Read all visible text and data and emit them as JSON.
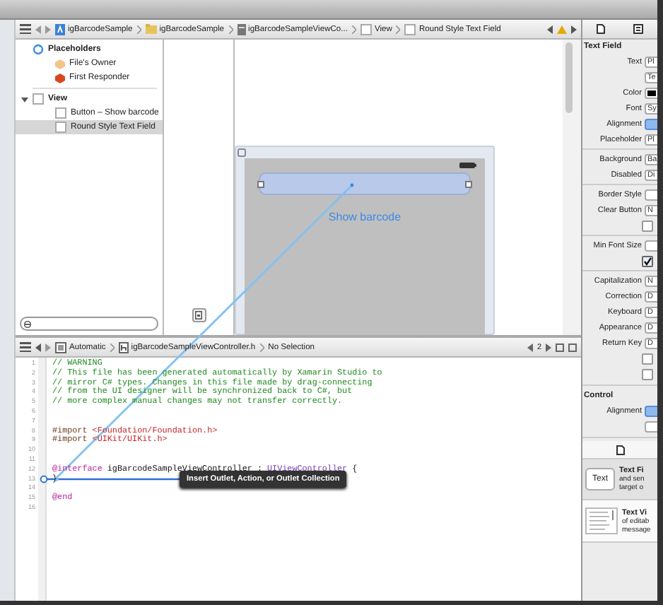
{
  "jump_bar": {
    "items": [
      {
        "label": "igBarcodeSample",
        "kind": "project"
      },
      {
        "label": "igBarcodeSample",
        "kind": "folder"
      },
      {
        "label": "igBarcodeSampleViewCo...",
        "kind": "file"
      },
      {
        "label": "View",
        "kind": "view"
      },
      {
        "label": "Round Style Text Field",
        "kind": "view"
      }
    ]
  },
  "outline": [
    {
      "label": "Placeholders",
      "kind": "placeholders",
      "selected": false,
      "children": [
        {
          "label": "File's Owner",
          "kind": "owner",
          "selected": false
        },
        {
          "label": "First Responder",
          "kind": "responder",
          "selected": false
        }
      ]
    },
    {
      "label": "View",
      "kind": "view",
      "expanded": true,
      "selected": false,
      "children": [
        {
          "label": "Button – Show barcode",
          "kind": "view",
          "selected": false
        },
        {
          "label": "Round Style Text Field",
          "kind": "view",
          "selected": true
        }
      ]
    }
  ],
  "canvas": {
    "text_field": {
      "selected": true
    },
    "button": {
      "label": "Show barcode"
    }
  },
  "editor": {
    "jump_bar": {
      "items": [
        {
          "label": "Automatic",
          "kind": "automatic"
        },
        {
          "label": "igBarcodeSampleViewController.h",
          "kind": "header"
        },
        {
          "label": "No Selection",
          "kind": "plain"
        }
      ],
      "counter": "2"
    },
    "lines": [
      {
        "number": "1",
        "segments": [
          {
            "text": "// WARNING",
            "kind": "comment"
          }
        ]
      },
      {
        "number": "2",
        "segments": [
          {
            "text": "// This file has been generated automatically by Xamarin Studio to",
            "kind": "comment"
          }
        ]
      },
      {
        "number": "3",
        "segments": [
          {
            "text": "// mirror C# types. Changes in this file made by drag-connecting",
            "kind": "comment"
          }
        ]
      },
      {
        "number": "4",
        "segments": [
          {
            "text": "// from the UI designer will be synchronized back to C#, but",
            "kind": "comment"
          }
        ]
      },
      {
        "number": "5",
        "segments": [
          {
            "text": "// more complex manual changes may not transfer correctly.",
            "kind": "comment"
          }
        ]
      },
      {
        "number": "6"
      },
      {
        "number": "7"
      },
      {
        "number": "8",
        "segments": [
          {
            "text": "#import ",
            "kind": "directive"
          },
          {
            "text": "<Foundation/Foundation.h>",
            "kind": "string"
          }
        ]
      },
      {
        "number": "9",
        "segments": [
          {
            "text": "#import ",
            "kind": "directive"
          },
          {
            "text": "<UIKit/UIKit.h>",
            "kind": "string"
          }
        ]
      },
      {
        "number": "10"
      },
      {
        "number": "11"
      },
      {
        "number": "12",
        "segments": [
          {
            "text": "@interface",
            "kind": "keyword"
          },
          {
            "text": " igBarcodeSampleViewController : ",
            "kind": "plain"
          },
          {
            "text": "UIViewController",
            "kind": "type"
          },
          {
            "text": " {",
            "kind": "plain"
          }
        ]
      },
      {
        "number": "13",
        "segments": [
          {
            "text": "}",
            "kind": "plain"
          }
        ]
      },
      {
        "number": "14"
      },
      {
        "number": "15",
        "segments": [
          {
            "text": "@end",
            "kind": "keyword"
          }
        ]
      },
      {
        "number": "16"
      }
    ],
    "tooltip": "Insert Outlet, Action, or Outlet Collection"
  },
  "inspector": {
    "sections": [
      {
        "title": "Text Field",
        "rows": [
          {
            "kind": "field",
            "label": "Text",
            "value": "Pl"
          },
          {
            "kind": "field",
            "value": "Te"
          },
          {
            "kind": "color",
            "label": "Color"
          },
          {
            "kind": "field",
            "label": "Font",
            "value": "Sy"
          },
          {
            "kind": "segmented",
            "label": "Alignment",
            "selected": true
          },
          {
            "kind": "field",
            "label": "Placeholder",
            "value": "Pl"
          },
          {
            "kind": "divider"
          },
          {
            "kind": "field",
            "label": "Background",
            "value": "Ba"
          },
          {
            "kind": "field",
            "label": "Disabled",
            "value": "Di"
          },
          {
            "kind": "divider"
          },
          {
            "kind": "field",
            "label": "Border Style"
          },
          {
            "kind": "field",
            "label": "Clear Button",
            "value": "N"
          },
          {
            "kind": "checkbox",
            "checked": false
          },
          {
            "kind": "divider"
          },
          {
            "kind": "field",
            "label": "Min Font Size"
          },
          {
            "kind": "checkbox",
            "checked": true
          },
          {
            "kind": "divider"
          },
          {
            "kind": "field",
            "label": "Capitalization",
            "value": "N"
          },
          {
            "kind": "field",
            "label": "Correction",
            "value": "D"
          },
          {
            "kind": "field",
            "label": "Keyboard",
            "value": "D"
          },
          {
            "kind": "field",
            "label": "Appearance",
            "value": "D"
          },
          {
            "kind": "field",
            "label": "Return Key",
            "value": "D"
          },
          {
            "kind": "checkbox",
            "checked": false
          },
          {
            "kind": "checkbox",
            "checked": false
          }
        ]
      },
      {
        "title": "Control",
        "rows": [
          {
            "kind": "segmented",
            "label": "Alignment",
            "selected": true
          },
          {
            "kind": "button"
          }
        ]
      }
    ],
    "library": [
      {
        "kind": "textfield",
        "badge": "Text",
        "title": "Text Fi",
        "lines": [
          "and sen",
          "target o"
        ]
      },
      {
        "kind": "textview",
        "title": "Text Vi",
        "lines": [
          "of editab",
          "message"
        ]
      }
    ]
  }
}
